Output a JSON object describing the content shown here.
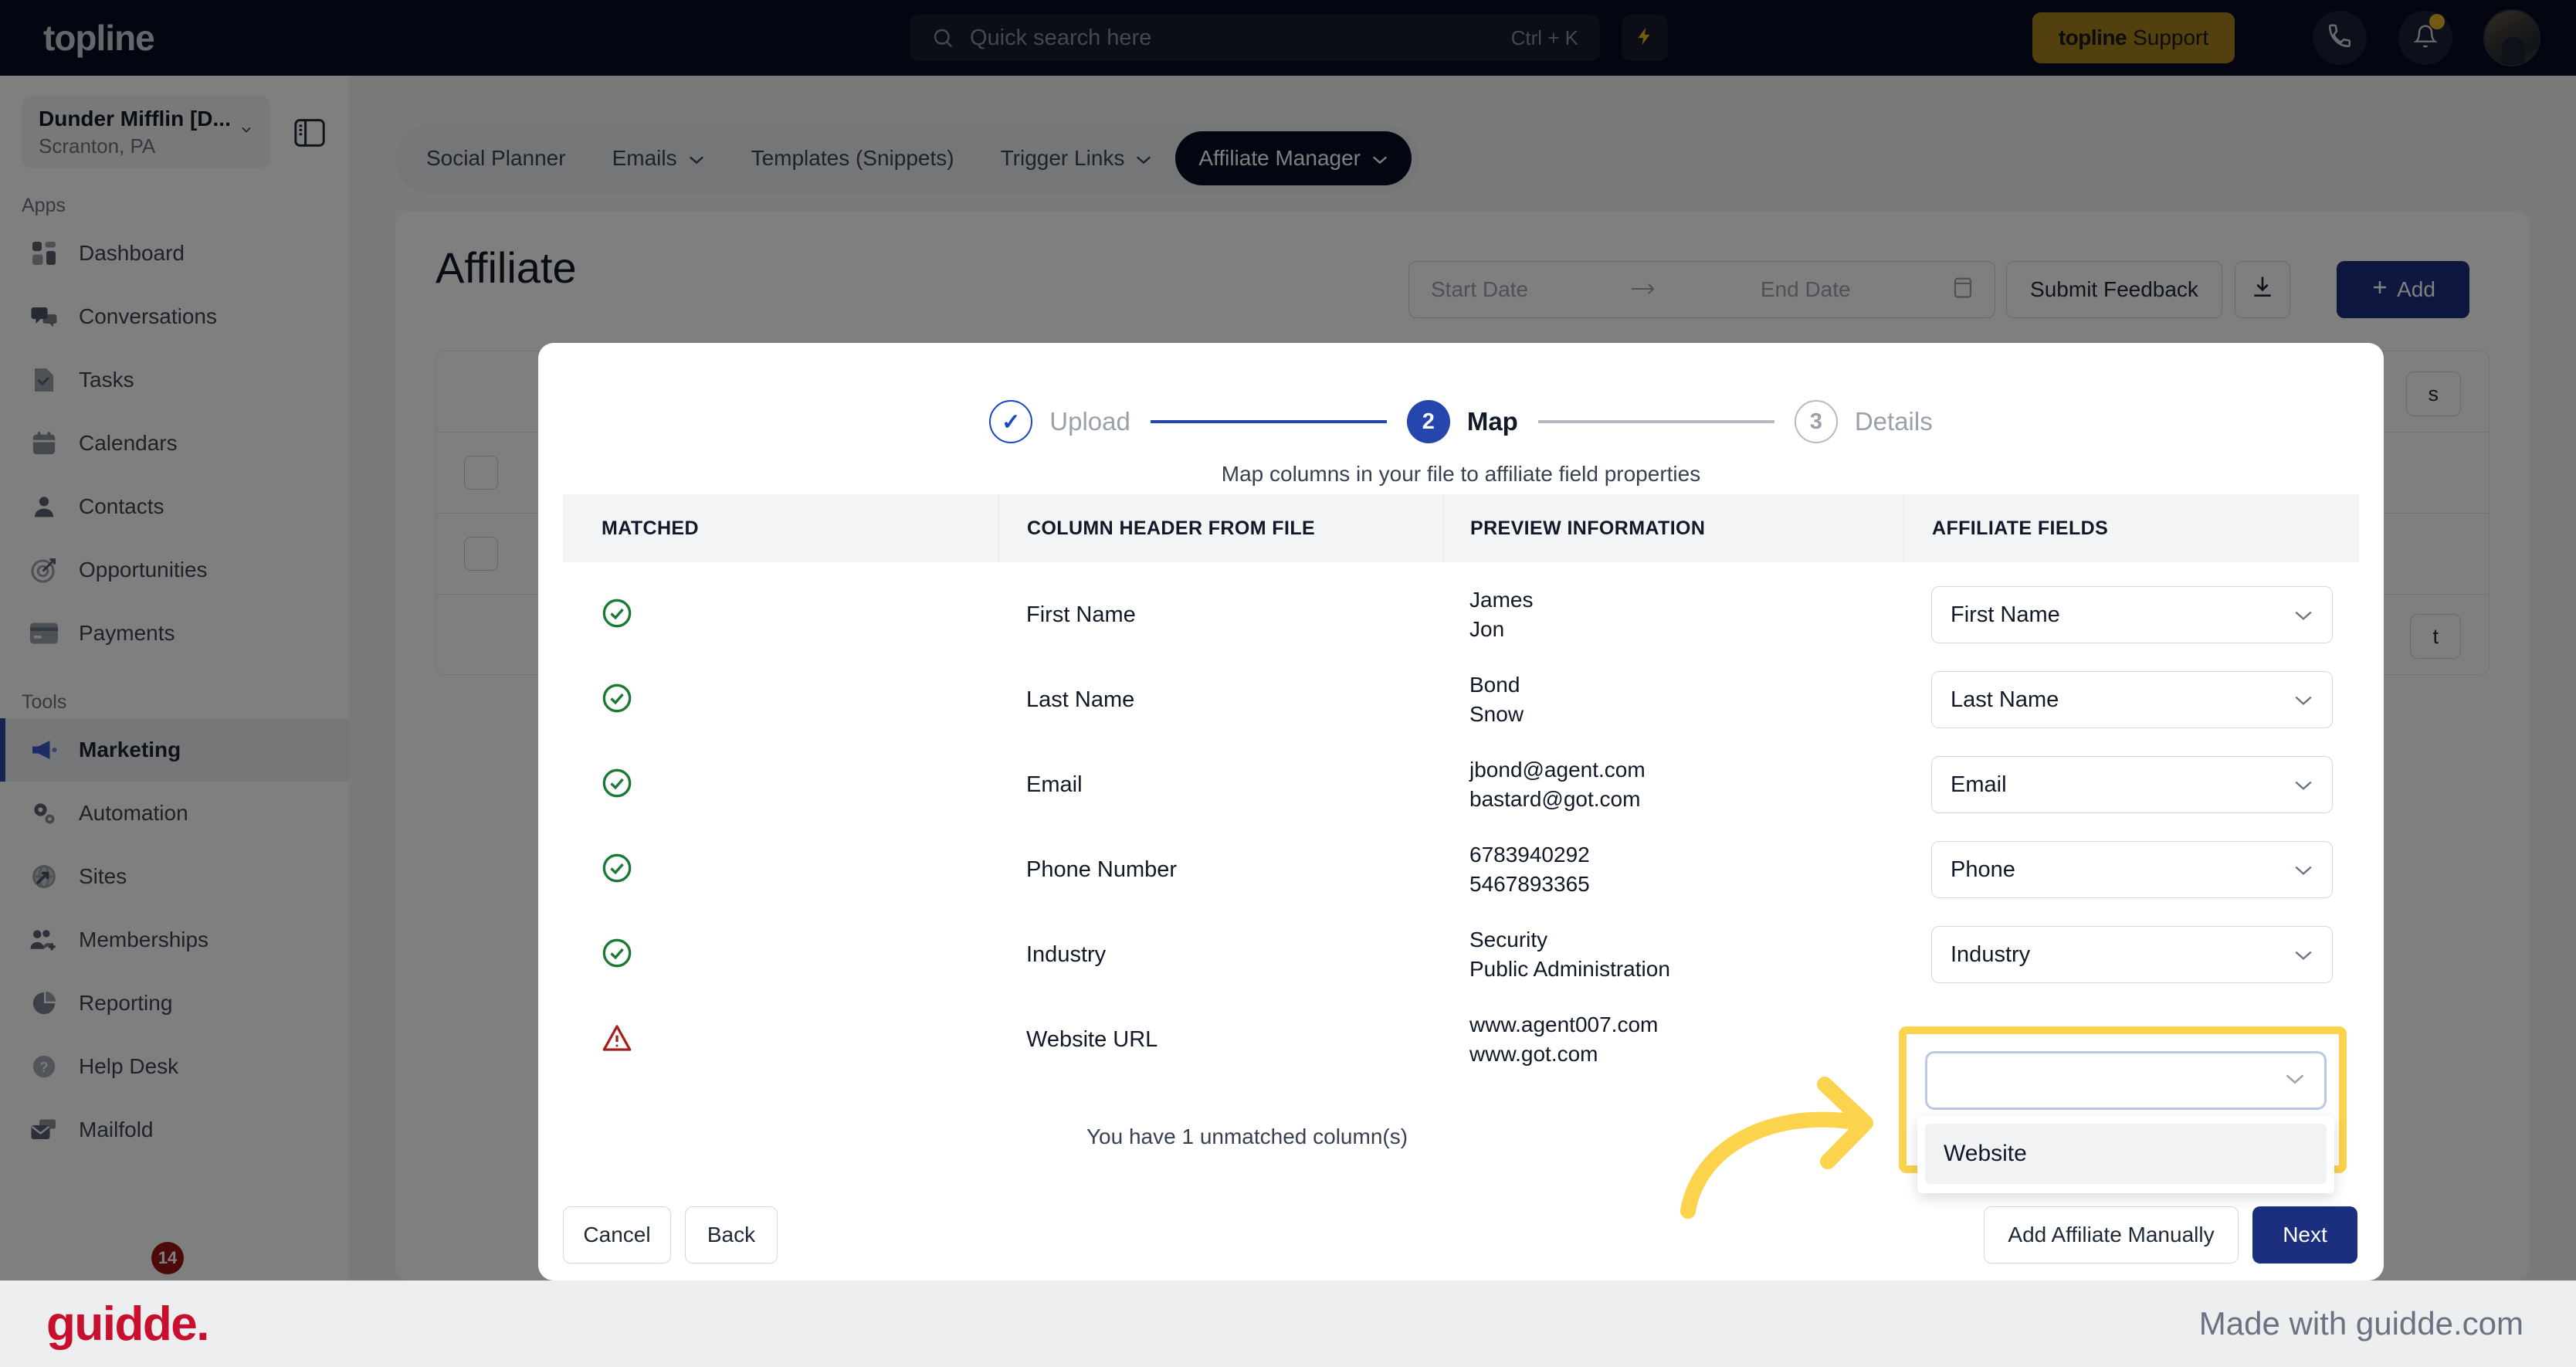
{
  "topbar": {
    "brand": "topline",
    "search": {
      "placeholder": "Quick search here",
      "shortcut": "Ctrl + K",
      "icon": "search-icon"
    },
    "bolt_icon": "lightning-bolt-icon",
    "support_button": {
      "brand": "topline",
      "label": "Support"
    },
    "phone_icon": "phone-icon",
    "bell_icon": "bell-icon",
    "avatar": "user-avatar"
  },
  "sidebar": {
    "location": {
      "name": "Dunder Mifflin [D...",
      "sub": "Scranton, PA",
      "chevron": "chevron-down-icon"
    },
    "panel_toggle_icon": "panel-toggle-icon",
    "groups": [
      {
        "label": "Apps",
        "items": [
          {
            "label": "Dashboard",
            "icon": "dashboard-icon"
          },
          {
            "label": "Conversations",
            "icon": "chat-bubbles-icon"
          },
          {
            "label": "Tasks",
            "icon": "task-check-icon"
          },
          {
            "label": "Calendars",
            "icon": "calendar-icon"
          },
          {
            "label": "Contacts",
            "icon": "person-icon"
          },
          {
            "label": "Opportunities",
            "icon": "target-icon"
          },
          {
            "label": "Payments",
            "icon": "credit-card-icon"
          }
        ]
      },
      {
        "label": "Tools",
        "items": [
          {
            "label": "Marketing",
            "icon": "megaphone-icon",
            "active": true
          },
          {
            "label": "Automation",
            "icon": "gears-icon"
          },
          {
            "label": "Sites",
            "icon": "globe-icon"
          },
          {
            "label": "Memberships",
            "icon": "people-plus-icon"
          },
          {
            "label": "Reporting",
            "icon": "pie-chart-icon"
          },
          {
            "label": "Help Desk",
            "icon": "question-circle-icon"
          },
          {
            "label": "Mailfold",
            "icon": "mail-stack-icon"
          }
        ]
      }
    ],
    "badge_count": "14"
  },
  "tabbar": {
    "tabs": [
      {
        "label": "Social Planner",
        "caret": false
      },
      {
        "label": "Emails",
        "caret": true
      },
      {
        "label": "Templates (Snippets)",
        "caret": false
      },
      {
        "label": "Trigger Links",
        "caret": true
      },
      {
        "label": "Affiliate Manager",
        "caret": true,
        "active": true
      }
    ]
  },
  "page": {
    "title": "Affiliate",
    "start_date_placeholder": "Start Date",
    "end_date_placeholder": "End Date",
    "date_arrow": "arrow-right-icon",
    "calendar_icon": "calendar-icon",
    "submit_feedback_label": "Submit Feedback",
    "download_icon": "download-icon",
    "add_label": "Add",
    "add_icon": "plus-icon",
    "bg_pill_label": "s",
    "bg_pill2_label": "t"
  },
  "modal": {
    "steps": [
      {
        "num": "✓",
        "label": "Upload",
        "state": "done"
      },
      {
        "num": "2",
        "label": "Map",
        "state": "current"
      },
      {
        "num": "3",
        "label": "Details",
        "state": "todo"
      }
    ],
    "subtitle": "Map columns in your file to affiliate field properties",
    "table": {
      "headers": [
        "MATCHED",
        "COLUMN HEADER FROM FILE",
        "PREVIEW INFORMATION",
        "AFFILIATE FIELDS"
      ],
      "rows": [
        {
          "matched": "check-circle-icon",
          "matched_state": "ok",
          "column": "First Name",
          "preview": [
            "James",
            "Jon"
          ],
          "field": "First Name"
        },
        {
          "matched": "check-circle-icon",
          "matched_state": "ok",
          "column": "Last Name",
          "preview": [
            "Bond",
            "Snow"
          ],
          "field": "Last Name"
        },
        {
          "matched": "check-circle-icon",
          "matched_state": "ok",
          "column": "Email",
          "preview": [
            "jbond@agent.com",
            "bastard@got.com"
          ],
          "field": "Email"
        },
        {
          "matched": "check-circle-icon",
          "matched_state": "ok",
          "column": "Phone Number",
          "preview": [
            "6783940292",
            "5467893365"
          ],
          "field": "Phone"
        },
        {
          "matched": "check-circle-icon",
          "matched_state": "ok",
          "column": "Industry",
          "preview": [
            "Security",
            "Public Administration"
          ],
          "field": "Industry"
        },
        {
          "matched": "warning-triangle-icon",
          "matched_state": "warn",
          "column": "Website URL",
          "preview": [
            "www.agent007.com",
            "www.got.com"
          ],
          "field": ""
        }
      ]
    },
    "unmatched_note": "You have 1 unmatched column(s)",
    "open_dropdown": {
      "value": "",
      "options": [
        "Website"
      ],
      "chevron": "chevron-down-icon"
    },
    "footer": {
      "cancel": "Cancel",
      "back": "Back",
      "add_manually": "Add Affiliate Manually",
      "next": "Next"
    }
  },
  "annotation": {
    "arrow_icon": "curved-arrow-right-icon",
    "color": "#fbd34d"
  },
  "guidde": {
    "logo": "guidde.",
    "made_with": "Made with guidde.com"
  },
  "colors": {
    "topbar_bg": "#070c20",
    "accent_blue": "#2547ad",
    "primary_button": "#1b2f7e",
    "support_gold": "#a5801f",
    "highlight_yellow": "#fbd34d",
    "success_green": "#1a7a33",
    "warning_red": "#a61f1f",
    "guidde_red": "#c8102e"
  }
}
